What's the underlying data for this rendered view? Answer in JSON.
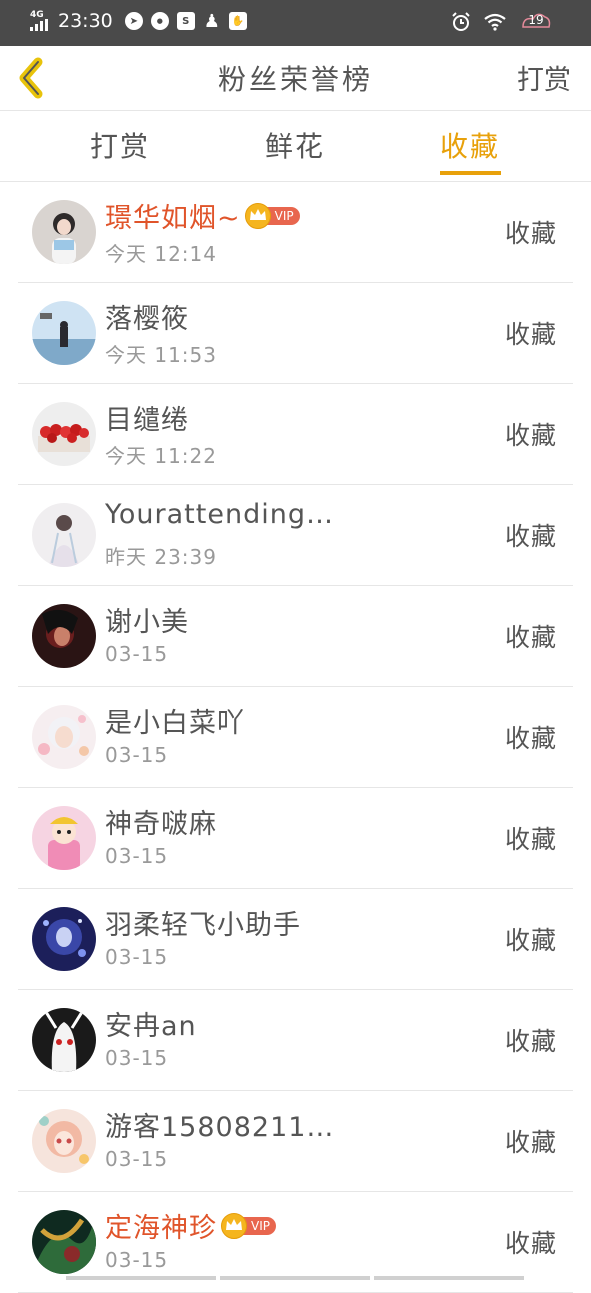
{
  "status_bar": {
    "network": "4G",
    "time": "23:30",
    "battery": "19"
  },
  "header": {
    "title": "粉丝荣誉榜",
    "right_action": "打赏"
  },
  "tabs": [
    {
      "label": "打赏",
      "active": false
    },
    {
      "label": "鲜花",
      "active": false
    },
    {
      "label": "收藏",
      "active": true
    }
  ],
  "accent_color": "#e8a10b",
  "vip_label": "VIP",
  "rows": [
    {
      "name": "璟华如烟~",
      "time": "今天 12:14",
      "action": "收藏",
      "vip": true
    },
    {
      "name": "落樱筱",
      "time": "今天 11:53",
      "action": "收藏",
      "vip": false
    },
    {
      "name": "目缱绻",
      "time": "今天 11:22",
      "action": "收藏",
      "vip": false
    },
    {
      "name": "Yourattending…",
      "time": "昨天 23:39",
      "action": "收藏",
      "vip": false
    },
    {
      "name": "谢小美",
      "time": "03-15",
      "action": "收藏",
      "vip": false
    },
    {
      "name": "是小白菜吖",
      "time": "03-15",
      "action": "收藏",
      "vip": false
    },
    {
      "name": "神奇啵麻",
      "time": "03-15",
      "action": "收藏",
      "vip": false
    },
    {
      "name": "羽柔轻飞小助手",
      "time": "03-15",
      "action": "收藏",
      "vip": false
    },
    {
      "name": "安冉an",
      "time": "03-15",
      "action": "收藏",
      "vip": false
    },
    {
      "name": "游客15808211…",
      "time": "03-15",
      "action": "收藏",
      "vip": false
    },
    {
      "name": "定海神珍",
      "time": "03-15",
      "action": "收藏",
      "vip": true
    }
  ]
}
